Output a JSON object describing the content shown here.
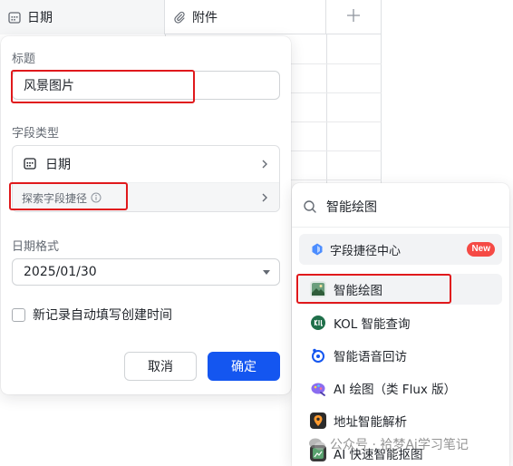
{
  "table": {
    "columns": [
      {
        "label": "日期",
        "icon": "calendar-icon"
      },
      {
        "label": "附件",
        "icon": "paperclip-icon"
      }
    ],
    "add_icon": "plus-icon"
  },
  "dialog": {
    "title_label": "标题",
    "title_value": "风景图片",
    "type_label": "字段类型",
    "type_value": "日期",
    "shortcut_label": "探索字段捷径",
    "format_label": "日期格式",
    "format_value": "2025/01/30",
    "auto_fill_label": "新记录自动填写创建时间",
    "cancel_label": "取消",
    "confirm_label": "确定",
    "accent": "#1456f0"
  },
  "menu": {
    "search_value": "智能绘图",
    "center_label": "字段捷径中心",
    "new_badge": "New",
    "items": [
      {
        "label": "智能绘图",
        "icon": "landscape-image-icon"
      },
      {
        "label": "KOL 智能查询",
        "icon": "kol-icon"
      },
      {
        "label": "智能语音回访",
        "icon": "voice-icon"
      },
      {
        "label": "AI 绘图（类 Flux 版）",
        "icon": "ai-paint-icon"
      },
      {
        "label": "地址智能解析",
        "icon": "location-icon"
      },
      {
        "label": "AI 快速智能抠图",
        "icon": "cutout-icon"
      }
    ]
  },
  "watermark": {
    "text": "公众号 · 袷梦Ai学习笔记"
  },
  "colors": {
    "highlight": "#e0191c",
    "new_badge": "#f54a45"
  }
}
